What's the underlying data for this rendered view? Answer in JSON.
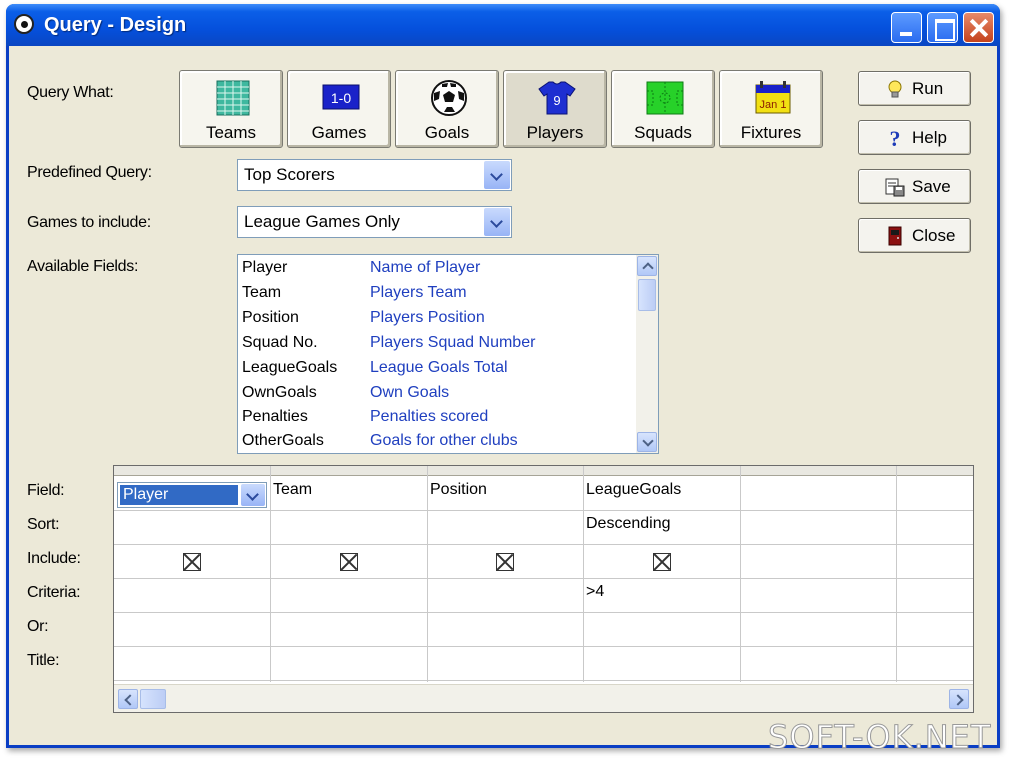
{
  "window": {
    "title": "Query - Design"
  },
  "labels": {
    "query_what": "Query What:",
    "predefined_query": "Predefined Query:",
    "games_to_include": "Games to include:",
    "available_fields": "Available Fields:"
  },
  "categories": [
    {
      "label": "Teams",
      "icon": "teams-grid-icon"
    },
    {
      "label": "Games",
      "icon": "score-board-icon",
      "icon_text": "1-0"
    },
    {
      "label": "Goals",
      "icon": "football-icon"
    },
    {
      "label": "Players",
      "icon": "shirt-icon",
      "icon_text": "9",
      "selected": true
    },
    {
      "label": "Squads",
      "icon": "pitch-icon"
    },
    {
      "label": "Fixtures",
      "icon": "calendar-icon",
      "icon_text": "Jan 1"
    }
  ],
  "actions": {
    "run": "Run",
    "help": "Help",
    "save": "Save",
    "close": "Close"
  },
  "predefined_query": {
    "value": "Top Scorers"
  },
  "games_to_include": {
    "value": "League Games Only"
  },
  "available_fields": [
    {
      "name": "Player",
      "desc": "Name of Player"
    },
    {
      "name": "Team",
      "desc": "Players Team"
    },
    {
      "name": "Position",
      "desc": "Players Position"
    },
    {
      "name": "Squad No.",
      "desc": "Players Squad Number"
    },
    {
      "name": "LeagueGoals",
      "desc": "League Goals Total"
    },
    {
      "name": "OwnGoals",
      "desc": "Own Goals"
    },
    {
      "name": "Penalties",
      "desc": "Penalties scored"
    },
    {
      "name": "OtherGoals",
      "desc": "Goals for other clubs"
    }
  ],
  "grid": {
    "row_labels": [
      "Field:",
      "Sort:",
      "Include:",
      "Criteria:",
      "Or:",
      "Title:"
    ],
    "columns": [
      {
        "field": "Player",
        "sort": "",
        "include": true,
        "criteria": ""
      },
      {
        "field": "Team",
        "sort": "",
        "include": true,
        "criteria": ""
      },
      {
        "field": "Position",
        "sort": "",
        "include": true,
        "criteria": ""
      },
      {
        "field": "LeagueGoals",
        "sort": "Descending",
        "include": true,
        "criteria": ">4"
      }
    ]
  },
  "watermark": "SOFT-OK.NET",
  "colors": {
    "title_bar": "#0550dc",
    "field_desc": "#1f3fbf",
    "selection": "#316ac5",
    "window_bg": "#ece9d8"
  }
}
